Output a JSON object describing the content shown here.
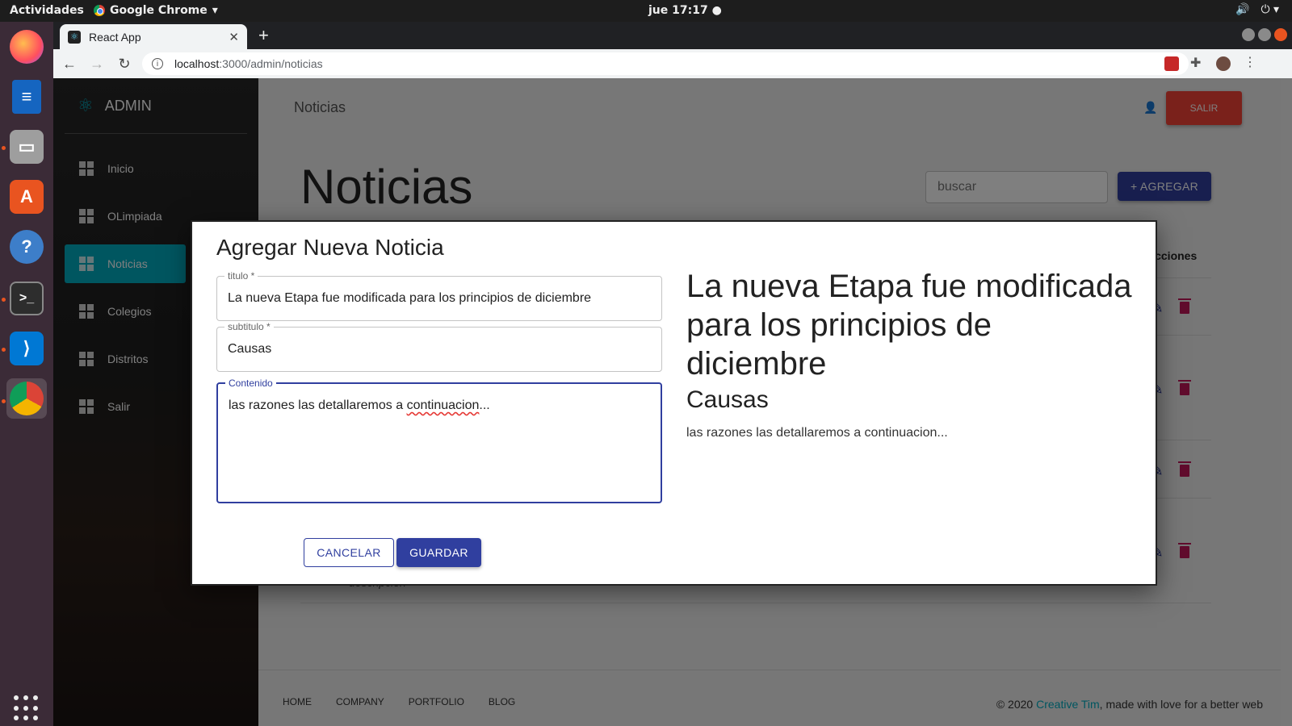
{
  "system": {
    "activities": "Actividades",
    "app_name": "Google Chrome",
    "clock": "jue 17:17 ●"
  },
  "browser": {
    "tab_title": "React App",
    "url_host": "localhost",
    "url_path": ":3000/admin/noticias"
  },
  "sidebar": {
    "brand": "ADMIN",
    "items": [
      {
        "label": "Inicio"
      },
      {
        "label": "OLimpiada"
      },
      {
        "label": "Noticias"
      },
      {
        "label": "Colegios"
      },
      {
        "label": "Distritos"
      },
      {
        "label": "Salir"
      }
    ]
  },
  "header": {
    "title": "Noticias",
    "logout_label": "SALIR"
  },
  "main": {
    "heading": "Noticias",
    "search_placeholder": "buscar",
    "add_label": "+ AGREGAR",
    "actions_header": "Acciones",
    "row_description": "descripcion"
  },
  "footer": {
    "links": [
      "HOME",
      "COMPANY",
      "PORTFOLIO",
      "BLOG"
    ],
    "copy_prefix": "© 2020 ",
    "copy_link": "Creative Tim",
    "copy_suffix": ", made with love for a better web"
  },
  "dialog": {
    "title": "Agregar Nueva Noticia",
    "titulo_label": "titulo *",
    "titulo_value": "La nueva Etapa fue modificada para los principios de diciembre",
    "subtitulo_label": "subtitulo *",
    "subtitulo_value": "Causas",
    "contenido_label": "Contenido",
    "contenido_before": "las razones las detallaremos a ",
    "contenido_misspelled": "continuacion",
    "contenido_after": "...",
    "cancel_label": "CANCELAR",
    "save_label": "GUARDAR",
    "preview_title": "La nueva Etapa fue modificada para los principios de diciembre",
    "preview_subtitle": "Causas",
    "preview_body": "las razones las detallaremos a continuacion..."
  },
  "colors": {
    "primary": "#303f9f",
    "sidebar_active": "#00acc1",
    "danger": "#f44336",
    "delete_icon": "#c2185b"
  }
}
